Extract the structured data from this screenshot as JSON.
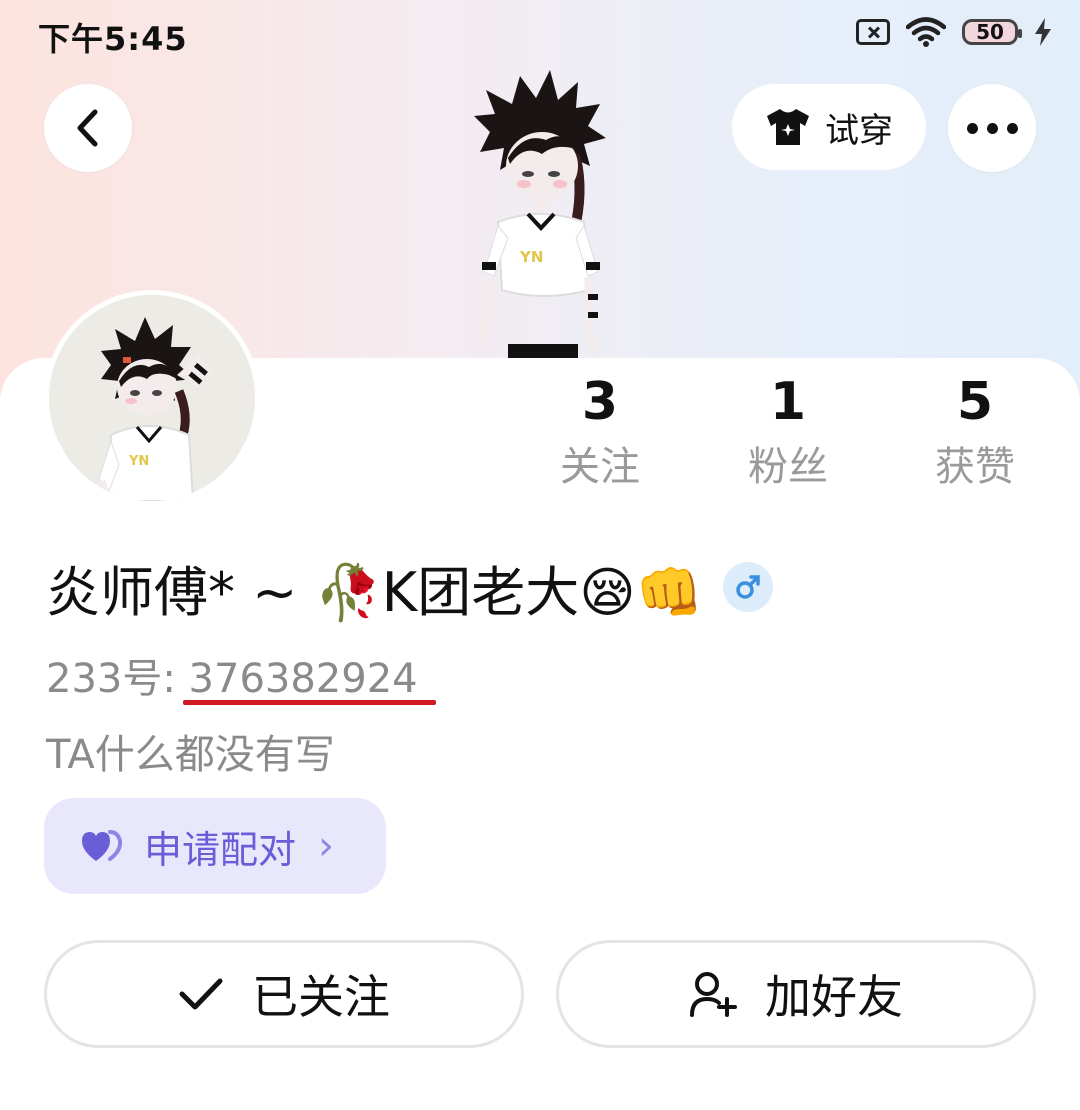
{
  "status_bar": {
    "time": "下午5:45",
    "battery": "50"
  },
  "header": {
    "try_on_label": "试穿"
  },
  "stats": [
    {
      "value": "3",
      "label": "关注"
    },
    {
      "value": "1",
      "label": "粉丝"
    },
    {
      "value": "5",
      "label": "获赞"
    }
  ],
  "profile": {
    "name": "炎师傅* ~ 🥀K团老大😪👊",
    "id_prefix": "233号: ",
    "id_number": "376382924",
    "bio": "TA什么都没有写"
  },
  "pair": {
    "label": "申请配对",
    "chevron": "›"
  },
  "actions": {
    "follow_label": "已关注",
    "add_friend_label": "加好友"
  },
  "colors": {
    "accent_purple": "#6a5ed8",
    "underline_red": "#d21a24",
    "gender_blue": "#3a8fe0"
  }
}
